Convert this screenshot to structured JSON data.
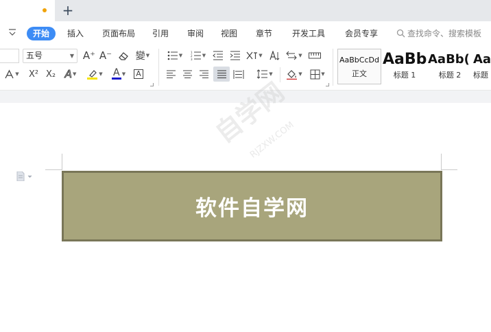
{
  "window": {
    "active_tab_modified": true,
    "new_tab_symbol": "+"
  },
  "menu": {
    "items": [
      "开始",
      "插入",
      "页面布局",
      "引用",
      "审阅",
      "视图",
      "章节",
      "开发工具",
      "会员专享"
    ],
    "active": "开始",
    "search_placeholder": "查找命令、搜索模板"
  },
  "ribbon": {
    "font_size": "五号",
    "icons": {
      "grow_font": "A⁺",
      "shrink_font": "A⁻",
      "superscript": "X²",
      "subscript": "X₂",
      "font_color": "A",
      "char_border": "A",
      "phonetic": "變"
    },
    "highlight_color": "#f5e400",
    "font_color_bar": "#1a1acc",
    "styles": [
      {
        "sample": "AaBbCcDd",
        "label": "正文"
      },
      {
        "sample": "AaBb",
        "label": "标题 1"
      },
      {
        "sample": "AaBb(",
        "label": "标题 2"
      },
      {
        "sample": "AaE",
        "label": "标题"
      }
    ]
  },
  "document": {
    "banner_text": "软件自学网",
    "banner_fill": "#a8a57c",
    "banner_border": "#797658",
    "watermark": "自学网",
    "watermark_sub": "RJZXW.COM"
  }
}
